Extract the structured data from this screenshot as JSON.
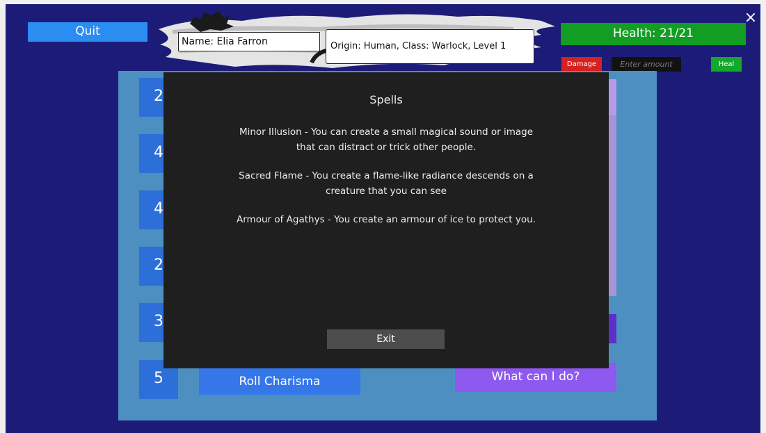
{
  "header": {
    "quit_label": "Quit",
    "close_icon": "×",
    "name": "Name: Elia Farron",
    "origin": "Origin: Human, Class: Warlock, Level 1"
  },
  "health": {
    "label": "Health: 21/21",
    "damage_label": "Damage",
    "amount_placeholder": "Enter amount",
    "heal_label": "Heal"
  },
  "stats": {
    "visible_values": [
      "2",
      "4",
      "4",
      "2",
      "3",
      "5"
    ]
  },
  "actions": {
    "roll_label": "Roll Charisma",
    "what_label": "What can I do?"
  },
  "modal": {
    "title": "Spells",
    "spells": [
      "Minor Illusion - You can create a small magical sound or image\nthat can distract or trick other people.",
      "Sacred Flame - You create a flame-like radiance descends on a\ncreature that you can see",
      "Armour of Agathys - You create an armour of ice to protect you."
    ],
    "exit_label": "Exit"
  },
  "colors": {
    "background": "#1c1c78",
    "panel": "#4d8fc0",
    "health_green": "#119e23",
    "damage_red": "#d42222",
    "stat_blue": "#2d6fd9",
    "accent_purple": "#8e59f0",
    "modal_bg": "#1f1f1f"
  }
}
